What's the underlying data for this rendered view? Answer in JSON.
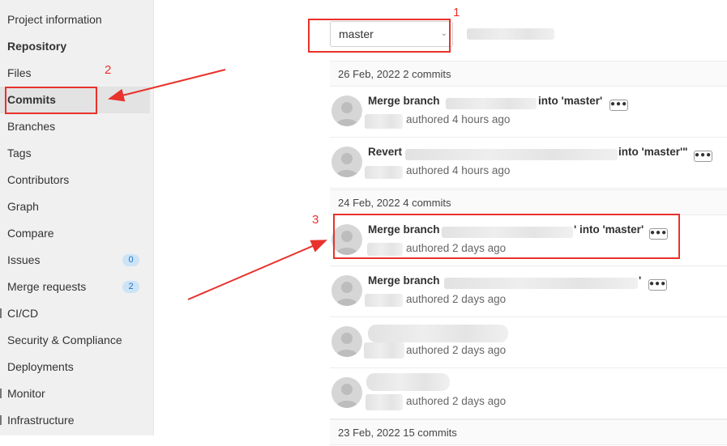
{
  "sidebar": {
    "items": [
      {
        "label": "Project information",
        "style": "normal"
      },
      {
        "label": "Repository",
        "style": "bold"
      },
      {
        "label": "Files",
        "style": "normal"
      },
      {
        "label": "Commits",
        "style": "active"
      },
      {
        "label": "Branches",
        "style": "normal"
      },
      {
        "label": "Tags",
        "style": "normal"
      },
      {
        "label": "Contributors",
        "style": "normal"
      },
      {
        "label": "Graph",
        "style": "normal"
      },
      {
        "label": "Compare",
        "style": "normal"
      },
      {
        "label": "Issues",
        "style": "normal",
        "badge": "0"
      },
      {
        "label": "Merge requests",
        "style": "normal",
        "badge": "2"
      },
      {
        "label": "CI/CD",
        "style": "normal"
      },
      {
        "label": "Security & Compliance",
        "style": "normal"
      },
      {
        "label": "Deployments",
        "style": "normal"
      },
      {
        "label": "Monitor",
        "style": "normal"
      },
      {
        "label": "Infrastructure",
        "style": "normal"
      }
    ]
  },
  "branch_select": {
    "value": "master"
  },
  "day_groups": [
    {
      "header": "26 Feb, 2022 2 commits"
    },
    {
      "header": "24 Feb, 2022 4 commits"
    },
    {
      "header": "23 Feb, 2022 15 commits"
    }
  ],
  "commits": [
    {
      "prefix": "Merge branch",
      "suffix": "into 'master'",
      "meta": "authored 4 hours ago"
    },
    {
      "prefix": "Revert",
      "suffix": "into 'master'\"",
      "meta": "authored 4 hours ago"
    },
    {
      "prefix": "Merge branch",
      "suffix": "' into 'master'",
      "meta": "authored 2 days ago"
    },
    {
      "prefix": "Merge branch",
      "suffix": "'",
      "meta": "authored 2 days ago"
    },
    {
      "prefix": "",
      "suffix": "",
      "meta": "authored 2 days ago"
    },
    {
      "prefix": "",
      "suffix": "",
      "meta": "authored 2 days ago"
    }
  ],
  "annotations": {
    "one": "1",
    "two": "2",
    "three": "3"
  },
  "colors": {
    "annotation": "#e8322b",
    "badge_bg": "#cce4f6",
    "badge_text": "#1f75cb"
  }
}
